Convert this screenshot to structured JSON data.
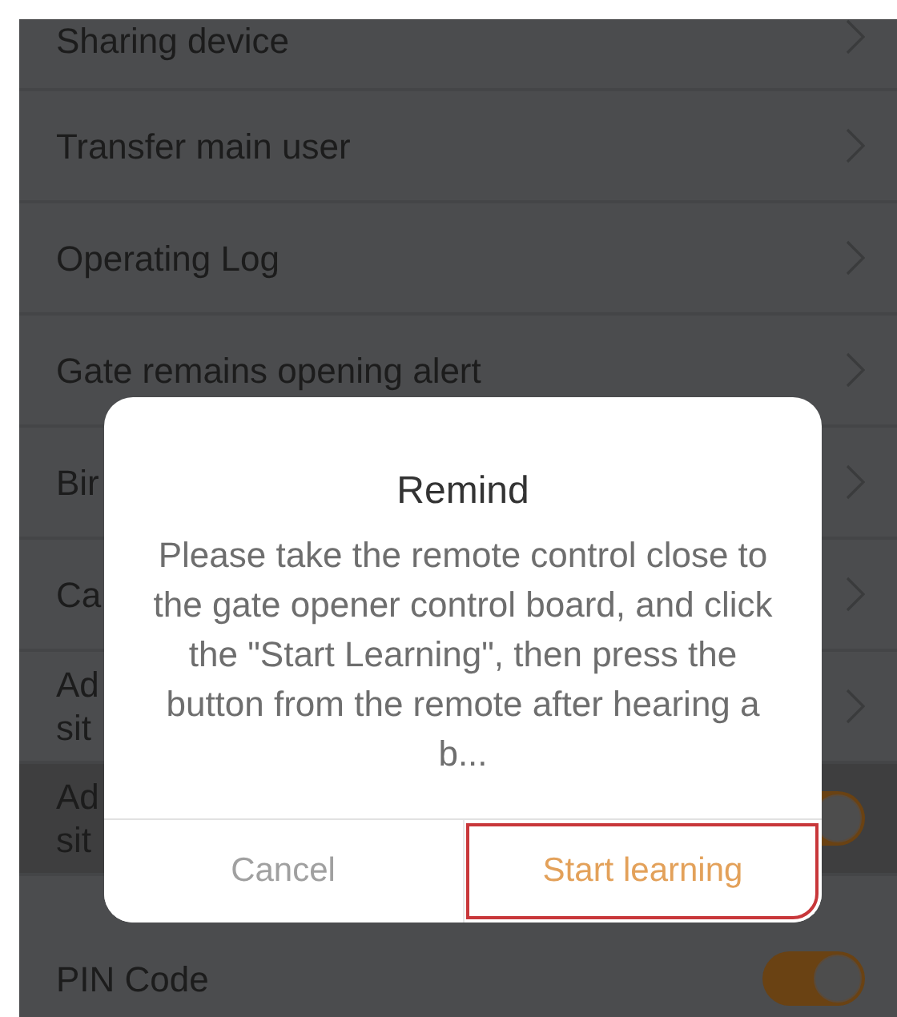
{
  "settings": [
    {
      "kind": "link",
      "lines": [
        "Sharing device"
      ]
    },
    {
      "kind": "link",
      "lines": [
        "Transfer main user"
      ]
    },
    {
      "kind": "link",
      "lines": [
        "Operating Log"
      ]
    },
    {
      "kind": "link",
      "lines": [
        "Gate remains opening alert"
      ]
    },
    {
      "kind": "link",
      "lines": [
        "Bir"
      ]
    },
    {
      "kind": "link",
      "lines": [
        "Ca"
      ]
    },
    {
      "kind": "link",
      "lines": [
        "Ad",
        "sit"
      ]
    },
    {
      "kind": "toggle",
      "lines": [
        "Ad",
        "sit"
      ],
      "on": true,
      "selected": true
    },
    {
      "kind": "toggle",
      "lines": [
        "PIN Code"
      ],
      "on": true,
      "selected": false,
      "section_start": true
    }
  ],
  "dialog": {
    "title": "Remind",
    "message": "Please take the remote control close to the gate opener control board, and click the \"Start Learning\", then press the button from the remote after hearing a b...",
    "buttons": [
      {
        "label": "Cancel",
        "kind": "cancel",
        "highlighted": false
      },
      {
        "label": "Start learning",
        "kind": "confirm",
        "highlighted": true
      }
    ]
  }
}
